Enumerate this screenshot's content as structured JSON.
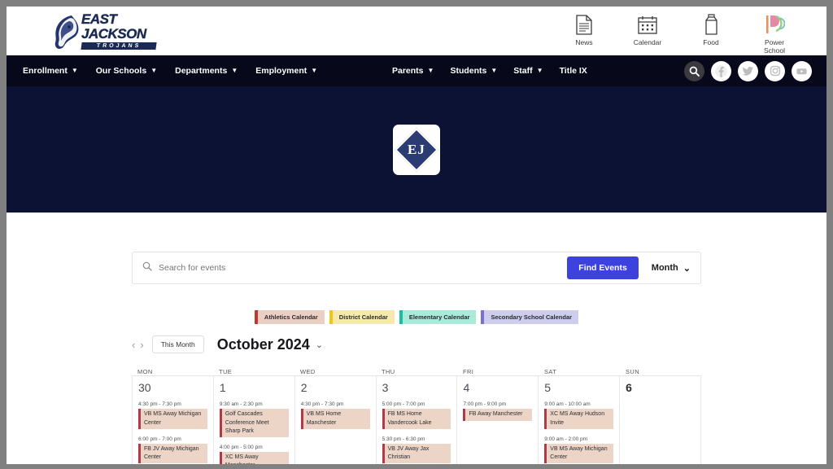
{
  "header": {
    "logo": {
      "line1": "EAST",
      "line2": "JACKSON",
      "tagline": "TROJANS"
    },
    "utility_items": [
      {
        "label": "News",
        "icon": "document-icon"
      },
      {
        "label": "Calendar",
        "icon": "calendar-icon"
      },
      {
        "label": "Food",
        "icon": "milk-carton-icon"
      },
      {
        "label": "Power School",
        "label_line1": "Power",
        "label_line2": "School",
        "icon": "powerschool-icon"
      }
    ]
  },
  "nav": {
    "left_items": [
      {
        "label": "Enrollment",
        "has_dropdown": true
      },
      {
        "label": "Our Schools",
        "has_dropdown": true
      },
      {
        "label": "Departments",
        "has_dropdown": true
      },
      {
        "label": "Employment",
        "has_dropdown": true
      }
    ],
    "mid_items": [
      {
        "label": "Parents",
        "has_dropdown": true
      },
      {
        "label": "Students",
        "has_dropdown": true
      },
      {
        "label": "Staff",
        "has_dropdown": true
      },
      {
        "label": "Title IX",
        "has_dropdown": false
      }
    ],
    "social": [
      {
        "name": "search-icon"
      },
      {
        "name": "facebook-icon"
      },
      {
        "name": "twitter-icon"
      },
      {
        "name": "instagram-icon"
      },
      {
        "name": "youtube-icon"
      }
    ],
    "background": "#07091a"
  },
  "hero": {
    "badge_text": "EJ",
    "background": "#0b1233"
  },
  "search": {
    "placeholder": "Search for events",
    "value": "",
    "find_button": "Find Events",
    "view_label": "Month",
    "button_color": "#3d42df"
  },
  "legend": [
    {
      "label": "Athletics Calendar",
      "bar": "#c0392f",
      "bg": "#eccfc3"
    },
    {
      "label": "District Calendar",
      "bar": "#f0c419",
      "bg": "#f7e9ab"
    },
    {
      "label": "Elementary Calendar",
      "bar": "#19bfa0",
      "bg": "#a9ead9"
    },
    {
      "label": "Secondary School Calendar",
      "bar": "#7b6fd1",
      "bg": "#cdcdee"
    }
  ],
  "calendar": {
    "prev_label": "‹",
    "next_label": "›",
    "this_month_label": "This Month",
    "title": "October 2024",
    "title_caret": "⌄",
    "day_headers": [
      "MON",
      "TUE",
      "WED",
      "THU",
      "FRI",
      "SAT",
      "SUN"
    ],
    "days": [
      {
        "number": "30",
        "bold": false,
        "events": [
          {
            "time": "4:30 pm - 7:30 pm",
            "title": "VB MS Away Michigan Center",
            "bar": "#b03a48",
            "bg": "#ecd5c6"
          },
          {
            "time": "6:00 pm - 7:00 pm",
            "title": "FB JV Away Michigan Center",
            "bar": "#b03a48",
            "bg": "#ecd5c6"
          }
        ]
      },
      {
        "number": "1",
        "bold": false,
        "events": [
          {
            "time": "9:30 am - 2:30 pm",
            "title": "Golf Cascades Conference Meet Sharp Park",
            "bar": "#b03a48",
            "bg": "#ecd5c6"
          },
          {
            "time": "4:00 pm - 5:00 pm",
            "title": "XC MS Away Manchester",
            "bar": "#b03a48",
            "bg": "#ecd5c6"
          }
        ]
      },
      {
        "number": "2",
        "bold": false,
        "events": [
          {
            "time": "4:30 pm - 7:30 pm",
            "title": "VB MS Home Manchester",
            "bar": "#b03a48",
            "bg": "#ecd5c6"
          }
        ]
      },
      {
        "number": "3",
        "bold": false,
        "events": [
          {
            "time": "5:00 pm - 7:00 pm",
            "title": "FB MS Home Vandercook Lake",
            "bar": "#b03a48",
            "bg": "#ecd5c6"
          },
          {
            "time": "5:30 pm - 6:30 pm",
            "title": "VB JV Away Jax Christian",
            "bar": "#b03a48",
            "bg": "#ecd5c6"
          }
        ]
      },
      {
        "number": "4",
        "bold": false,
        "events": [
          {
            "time": "7:00 pm - 9:00 pm",
            "title": "FB Away Manchester",
            "bar": "#b03a48",
            "bg": "#ecd5c6"
          }
        ]
      },
      {
        "number": "5",
        "bold": false,
        "events": [
          {
            "time": "9:00 am - 10:00 am",
            "title": "XC MS Away Hudson Invite",
            "bar": "#b03a48",
            "bg": "#ecd5c6"
          },
          {
            "time": "9:00 am - 2:00 pm",
            "title": "VB MS Away Michigan Center",
            "bar": "#b03a48",
            "bg": "#ecd5c6"
          }
        ]
      },
      {
        "number": "6",
        "bold": true,
        "events": []
      }
    ]
  }
}
